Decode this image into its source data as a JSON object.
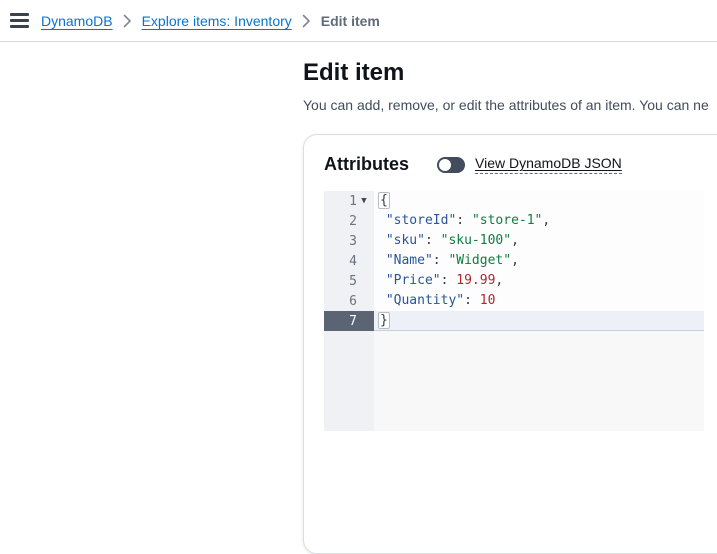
{
  "breadcrumb": {
    "items": [
      {
        "label": "DynamoDB",
        "type": "link"
      },
      {
        "label": "Explore items: Inventory",
        "type": "link"
      },
      {
        "label": "Edit item",
        "type": "current"
      }
    ],
    "separator_icon": "chevron-right-icon",
    "menu_icon": "hamburger-menu-icon"
  },
  "page": {
    "title": "Edit item",
    "description": "You can add, remove, or edit the attributes of an item. You can ne"
  },
  "card": {
    "heading": "Attributes",
    "toggle": {
      "label": "View DynamoDB JSON",
      "state": "off"
    }
  },
  "editor": {
    "language": "json",
    "active_line": 7,
    "fold_icon": "triangle-down-icon",
    "lines": [
      {
        "number": 1,
        "fold": true,
        "segments": [
          {
            "t": "{",
            "c": "bracket"
          }
        ]
      },
      {
        "number": 2,
        "segments": [
          {
            "t": " ",
            "c": "plain"
          },
          {
            "t": "\"storeId\"",
            "c": "key"
          },
          {
            "t": ": ",
            "c": "plain"
          },
          {
            "t": "\"store-1\"",
            "c": "string"
          },
          {
            "t": ",",
            "c": "plain"
          }
        ]
      },
      {
        "number": 3,
        "segments": [
          {
            "t": " ",
            "c": "plain"
          },
          {
            "t": "\"sku\"",
            "c": "key"
          },
          {
            "t": ": ",
            "c": "plain"
          },
          {
            "t": "\"sku-100\"",
            "c": "string"
          },
          {
            "t": ",",
            "c": "plain"
          }
        ]
      },
      {
        "number": 4,
        "segments": [
          {
            "t": " ",
            "c": "plain"
          },
          {
            "t": "\"Name\"",
            "c": "key"
          },
          {
            "t": ": ",
            "c": "plain"
          },
          {
            "t": "\"Widget\"",
            "c": "string"
          },
          {
            "t": ",",
            "c": "plain"
          }
        ]
      },
      {
        "number": 5,
        "segments": [
          {
            "t": " ",
            "c": "plain"
          },
          {
            "t": "\"Price\"",
            "c": "key"
          },
          {
            "t": ": ",
            "c": "plain"
          },
          {
            "t": "19.99",
            "c": "number"
          },
          {
            "t": ",",
            "c": "plain"
          }
        ]
      },
      {
        "number": 6,
        "segments": [
          {
            "t": " ",
            "c": "plain"
          },
          {
            "t": "\"Quantity\"",
            "c": "key"
          },
          {
            "t": ": ",
            "c": "plain"
          },
          {
            "t": "10",
            "c": "number"
          }
        ]
      },
      {
        "number": 7,
        "segments": [
          {
            "t": "}",
            "c": "bracket"
          }
        ]
      }
    ]
  },
  "colors": {
    "link_blue": "#0972d3",
    "breadcrumb_current": "#5f6b7a",
    "toggle_off_track": "#414d5c",
    "syntax_key": "#2a5598",
    "syntax_string": "#0f7d3f",
    "syntax_number": "#b1262d",
    "active_gutter": "#5a6472",
    "gutter_bg": "#eff1f4"
  }
}
